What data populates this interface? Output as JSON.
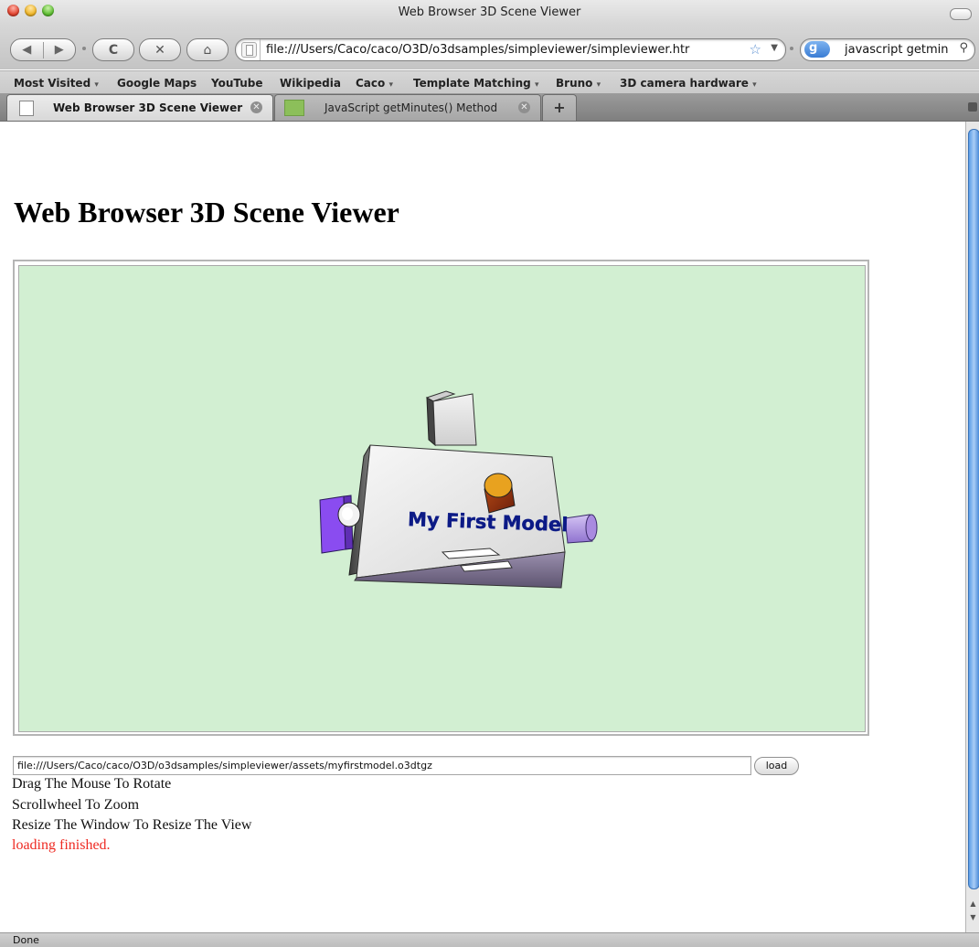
{
  "window": {
    "title": "Web Browser 3D Scene Viewer"
  },
  "toolbar": {
    "back_glyph": "◀",
    "forward_glyph": "▶",
    "reload_glyph": "C",
    "stop_glyph": "✕",
    "home_glyph": "⌂",
    "url": "file:///Users/Caco/caco/O3D/o3dsamples/simpleviewer/simpleviewer.htr",
    "star_glyph": "☆",
    "dropdown_glyph": "▼",
    "search_query": "javascript getmin",
    "search_glyph": "⚲"
  },
  "bookmarks": [
    {
      "label": "Most Visited",
      "menu": true
    },
    {
      "label": "Google Maps",
      "menu": false
    },
    {
      "label": "YouTube",
      "menu": false
    },
    {
      "label": "Wikipedia",
      "menu": false
    },
    {
      "label": "Caco",
      "menu": true
    },
    {
      "label": "Template Matching",
      "menu": true
    },
    {
      "label": "Bruno",
      "menu": true
    },
    {
      "label": "3D camera hardware",
      "menu": true
    }
  ],
  "bookmark_menu_arrow": "▾",
  "tabs": [
    {
      "label": "Web Browser 3D Scene Viewer",
      "active": true
    },
    {
      "label": "JavaScript getMinutes() Method",
      "active": false
    }
  ],
  "tab_close_glyph": "✕",
  "new_tab_glyph": "+",
  "page": {
    "heading": "Web Browser 3D Scene Viewer",
    "model_label": "My First Model",
    "file_path": "file:///Users/Caco/caco/O3D/o3dsamples/simpleviewer/assets/myfirstmodel.o3dtgz",
    "load_label": "load",
    "instructions": [
      "Drag The Mouse To Rotate",
      "Scrollwheel To Zoom",
      "Resize The Window To Resize The View"
    ],
    "status": "loading finished."
  },
  "colors": {
    "canvas_bg": "#d2efd2",
    "status_text": "#ee2a22",
    "model_label": "#0c1a86",
    "model_body": "#e6e6e6",
    "purple_block": "#8a4cf0",
    "lens": "#b79ee8",
    "knob": "#e8a21f"
  },
  "statusbar": {
    "text": "Done"
  }
}
